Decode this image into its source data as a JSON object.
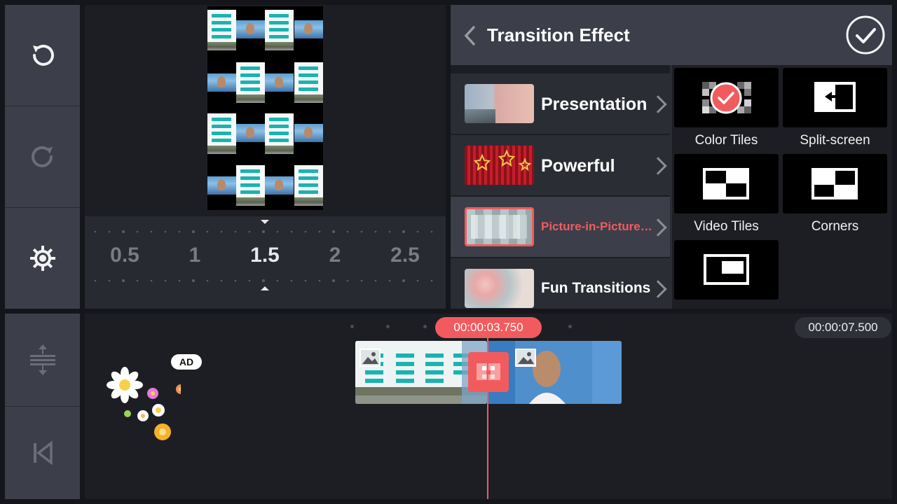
{
  "app": {
    "accent": "#f25b5e",
    "panel_bg": "#3c3f49",
    "bg": "#15161b"
  },
  "tools": [
    {
      "name": "undo",
      "icon": "undo-icon",
      "enabled": true
    },
    {
      "name": "redo",
      "icon": "redo-icon",
      "enabled": false
    },
    {
      "name": "settings",
      "icon": "gear-icon",
      "enabled": true
    },
    {
      "name": "fit-timeline",
      "icon": "expand-vertical-icon",
      "enabled": false
    },
    {
      "name": "go-to-start",
      "icon": "skip-to-start-icon",
      "enabled": false
    }
  ],
  "speed": {
    "ticks": [
      "0.5",
      "1",
      "1.5",
      "2",
      "2.5"
    ],
    "selected": "1.5"
  },
  "transition": {
    "title": "Transition Effect",
    "categories": [
      {
        "label": "Presentation"
      },
      {
        "label": "Powerful"
      },
      {
        "label": "Picture-in-Picture…"
      },
      {
        "label": "Fun Transitions"
      }
    ],
    "selected_category": "Picture-in-Picture…",
    "effects": [
      {
        "label": "Color Tiles",
        "selected": true
      },
      {
        "label": "Split-screen"
      },
      {
        "label": "Video Tiles"
      },
      {
        "label": "Corners"
      },
      {
        "label": ""
      }
    ]
  },
  "timeline": {
    "playhead_time": "00:00:03.750",
    "total_time": "00:00:07.500",
    "ad_label": "AD"
  }
}
